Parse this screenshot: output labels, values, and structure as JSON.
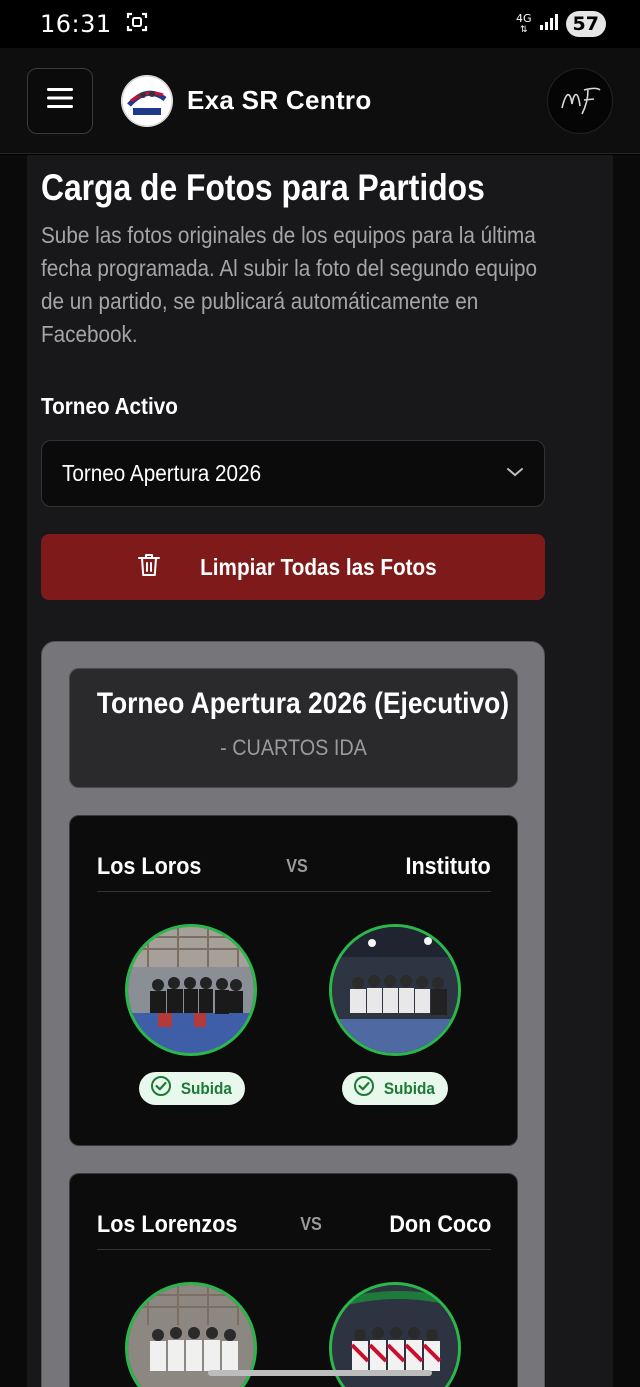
{
  "status_bar": {
    "time": "16:31",
    "network": "4G",
    "battery": "57"
  },
  "header": {
    "brand_name": "Exa SR Centro",
    "logo_text": "EXASR"
  },
  "page": {
    "title": "Carga de Fotos para Partidos",
    "subtitle": "Sube las fotos originales de los equipos para la última fecha programada. Al subir la foto del segundo equipo de un partido, se publicará automáticamente en Facebook.",
    "tournament_label": "Torneo Activo",
    "tournament_selected": "Torneo Apertura 2026",
    "clear_button": "Limpiar Todas las Fotos"
  },
  "tournament": {
    "name": "Torneo Apertura 2026 (Ejecutivo)",
    "round": "- CUARTOS IDA"
  },
  "matches": [
    {
      "home": "Los Loros",
      "vs": "VS",
      "away": "Instituto",
      "home_status": "Subida",
      "away_status": "Subida"
    },
    {
      "home": "Los Lorenzos",
      "vs": "VS",
      "away": "Don Coco"
    }
  ],
  "colors": {
    "accent_red": "#7f1a1a",
    "success_green": "#2bb84a",
    "success_text": "#1d7a36"
  }
}
